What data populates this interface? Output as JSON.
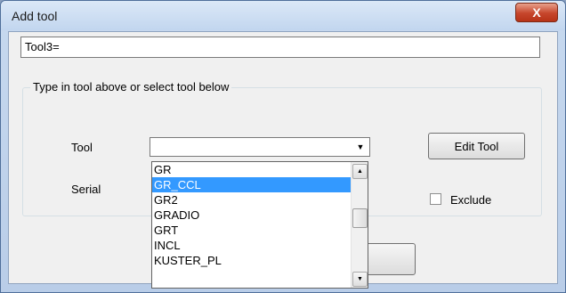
{
  "window": {
    "title": "Add tool",
    "close_glyph": "X"
  },
  "tool_input": {
    "value": "Tool3="
  },
  "group": {
    "legend": "Type in tool above or select tool below"
  },
  "tool_field": {
    "label": "Tool",
    "value": ""
  },
  "serial_field": {
    "label": "Serial"
  },
  "edit_tool_button": {
    "label": "Edit Tool"
  },
  "exclude_checkbox": {
    "label": "Exclude",
    "checked": false
  },
  "dropdown": {
    "items": [
      "GR",
      "GR_CCL",
      "GR2",
      "GRADIO",
      "GRT",
      "INCL",
      "KUSTER_PL"
    ],
    "selected": "GR_CCL",
    "scroll_up": "▲",
    "scroll_down": "▼"
  },
  "combo_arrow": "▼"
}
